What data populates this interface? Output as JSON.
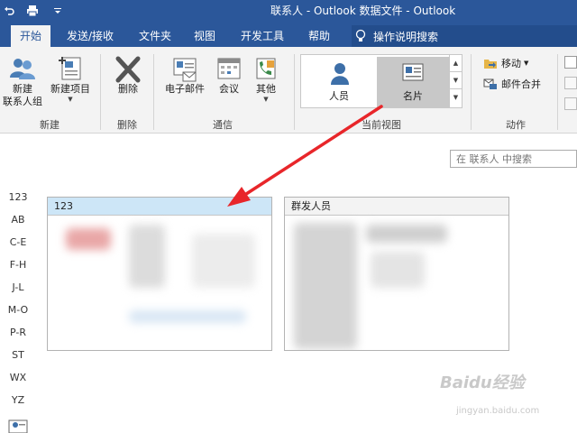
{
  "window": {
    "title": "联系人 - Outlook 数据文件  -  Outlook"
  },
  "tabs": [
    {
      "label": "开始",
      "active": true
    },
    {
      "label": "发送/接收",
      "active": false
    },
    {
      "label": "文件夹",
      "active": false
    },
    {
      "label": "视图",
      "active": false
    },
    {
      "label": "开发工具",
      "active": false
    },
    {
      "label": "帮助",
      "active": false
    }
  ],
  "tell_me": {
    "label": "操作说明搜索"
  },
  "ribbon": {
    "new_group": {
      "new_contact_group_line1": "新建",
      "new_contact_group_line2": "联系人组",
      "new_items": "新建项目",
      "label": "新建"
    },
    "delete_group": {
      "delete": "删除",
      "label": "删除"
    },
    "communicate_group": {
      "email": "电子邮件",
      "meeting": "会议",
      "more": "其他",
      "label": "通信"
    },
    "current_view_group": {
      "people": "人员",
      "business_card": "名片",
      "label": "当前视图"
    },
    "actions_group": {
      "move": "移动",
      "mail_merge": "邮件合并",
      "label": "动作"
    }
  },
  "search": {
    "placeholder": "在 联系人 中搜索"
  },
  "alphabet_index": [
    "123",
    "AB",
    "C-E",
    "F-H",
    "J-L",
    "M-O",
    "P-R",
    "ST",
    "WX",
    "YZ"
  ],
  "cards": [
    {
      "name": "123",
      "selected": true
    },
    {
      "name": "群发人员",
      "selected": false
    }
  ],
  "watermark": {
    "brand": "Baidu经验",
    "url": "jingyan.baidu.com"
  },
  "colors": {
    "title_bar": "#2b579a",
    "ribbon_bg": "#f3f3f3",
    "selected_card_header": "#cde6f7",
    "annotation_arrow": "#e8262a"
  }
}
